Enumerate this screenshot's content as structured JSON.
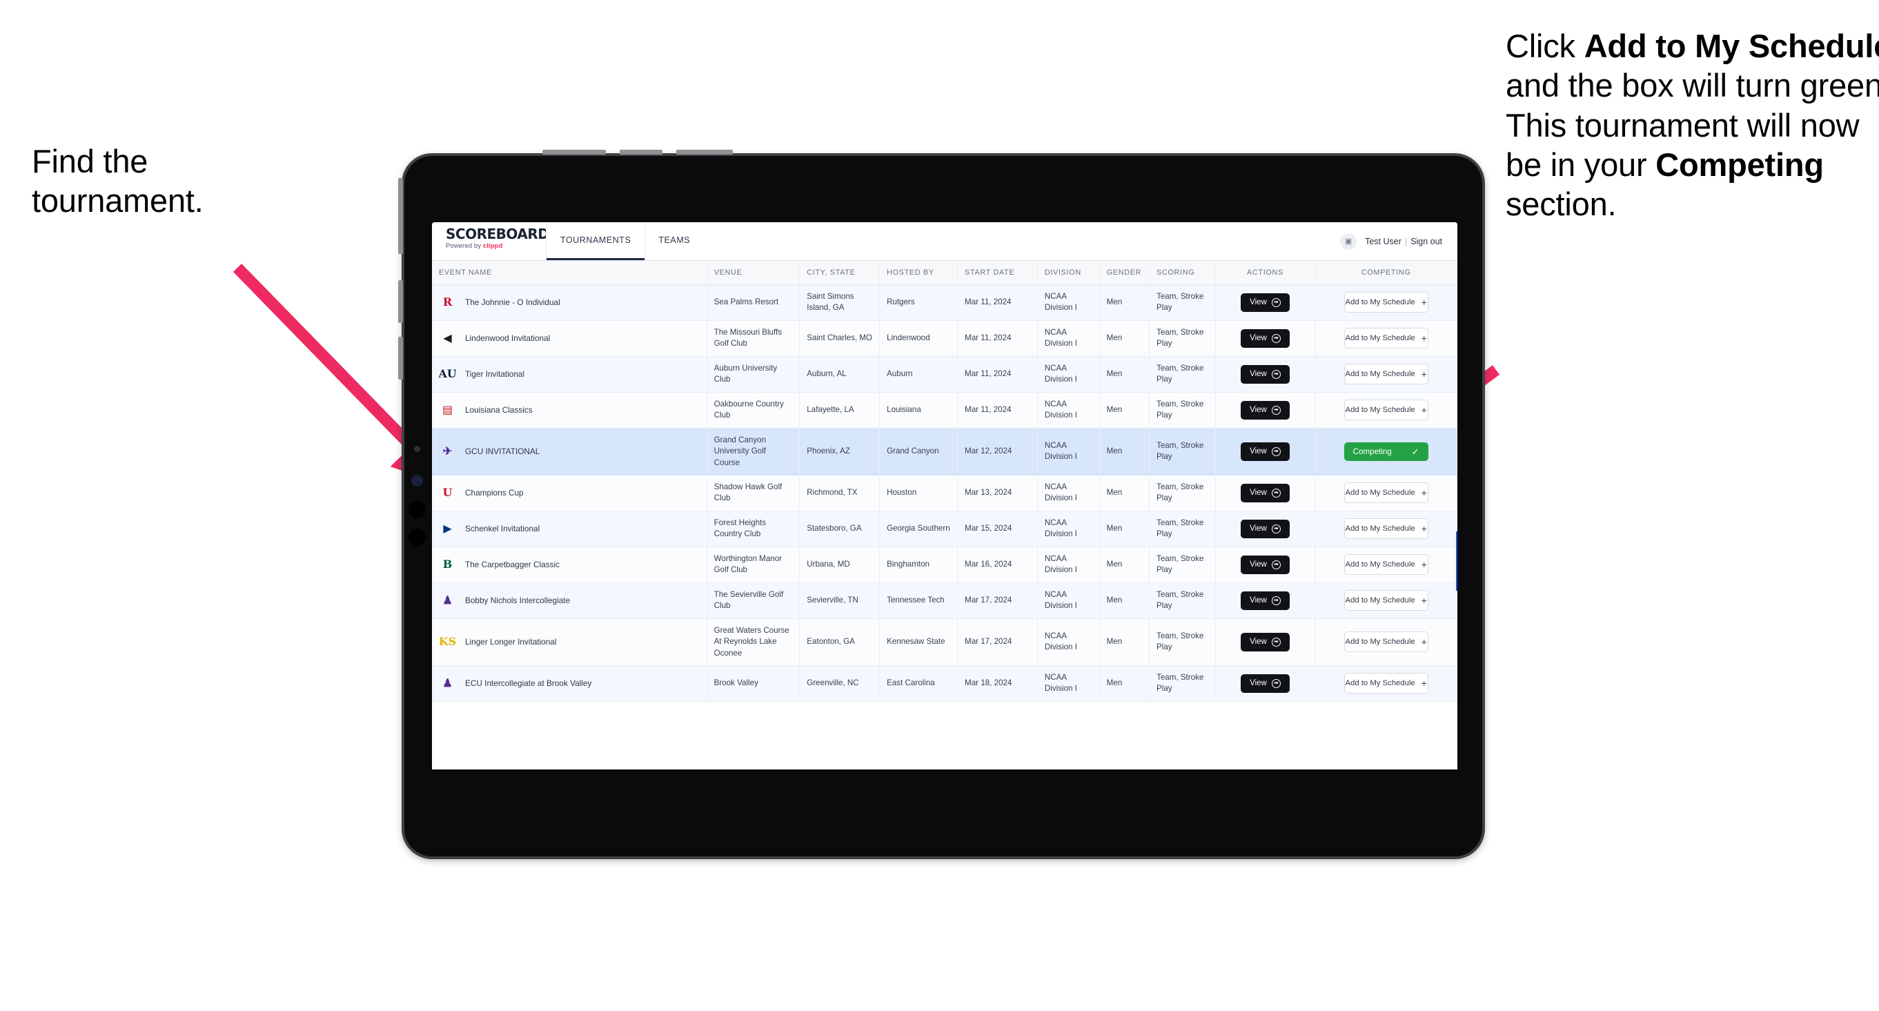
{
  "annotations": {
    "left": {
      "line1": "Find the",
      "line2": "tournament."
    },
    "right": {
      "p1a": "Click ",
      "p1b": "Add to My Schedule",
      "p1c": " and the box will turn green. This tournament will now be in your ",
      "p1d": "Competing",
      "p1e": " section."
    }
  },
  "app": {
    "brand": {
      "title": "SCOREBOARD",
      "powered_prefix": "Powered by ",
      "powered_brand": "clippd"
    },
    "nav": [
      {
        "label": "TOURNAMENTS",
        "active": true
      },
      {
        "label": "TEAMS",
        "active": false
      }
    ],
    "user": {
      "avatar_glyph": "▣",
      "name": "Test User",
      "separator": "|",
      "sign_out": "Sign out"
    },
    "table": {
      "columns": [
        "EVENT NAME",
        "VENUE",
        "CITY, STATE",
        "HOSTED BY",
        "START DATE",
        "DIVISION",
        "GENDER",
        "SCORING",
        "ACTIONS",
        "COMPETING"
      ],
      "view_label": "View",
      "add_label": "Add to My Schedule",
      "competing_label": "Competing",
      "rows": [
        {
          "event": "The Johnnie - O Individual",
          "venue": "Sea Palms Resort",
          "city": "Saint Simons Island, GA",
          "host": "Rutgers",
          "date": "Mar 11, 2024",
          "division": "NCAA Division I",
          "gender": "Men",
          "scoring": "Team, Stroke Play",
          "competing": false,
          "logo": {
            "text": "R",
            "color": "#c8102e",
            "bg": "transparent"
          }
        },
        {
          "event": "Lindenwood Invitational",
          "venue": "The Missouri Bluffs Golf Club",
          "city": "Saint Charles, MO",
          "host": "Lindenwood",
          "date": "Mar 11, 2024",
          "division": "NCAA Division I",
          "gender": "Men",
          "scoring": "Team, Stroke Play",
          "competing": false,
          "logo": {
            "text": "◀",
            "color": "#1d1d1d",
            "bg": "transparent"
          }
        },
        {
          "event": "Tiger Invitational",
          "venue": "Auburn University Club",
          "city": "Auburn, AL",
          "host": "Auburn",
          "date": "Mar 11, 2024",
          "division": "NCAA Division I",
          "gender": "Men",
          "scoring": "Team, Stroke Play",
          "competing": false,
          "logo": {
            "text": "AU",
            "color": "#0c2340",
            "bg": "transparent"
          }
        },
        {
          "event": "Louisiana Classics",
          "venue": "Oakbourne Country Club",
          "city": "Lafayette, LA",
          "host": "Louisiana",
          "date": "Mar 11, 2024",
          "division": "NCAA Division I",
          "gender": "Men",
          "scoring": "Team, Stroke Play",
          "competing": false,
          "logo": {
            "text": "▤",
            "color": "#ce181e",
            "bg": "transparent"
          }
        },
        {
          "event": "GCU INVITATIONAL",
          "venue": "Grand Canyon University Golf Course",
          "city": "Phoenix, AZ",
          "host": "Grand Canyon",
          "date": "Mar 12, 2024",
          "division": "NCAA Division I",
          "gender": "Men",
          "scoring": "Team, Stroke Play",
          "competing": true,
          "logo": {
            "text": "✈",
            "color": "#522398",
            "bg": "transparent"
          }
        },
        {
          "event": "Champions Cup",
          "venue": "Shadow Hawk Golf Club",
          "city": "Richmond, TX",
          "host": "Houston",
          "date": "Mar 13, 2024",
          "division": "NCAA Division I",
          "gender": "Men",
          "scoring": "Team, Stroke Play",
          "competing": false,
          "logo": {
            "text": "U",
            "color": "#c8102e",
            "bg": "transparent"
          }
        },
        {
          "event": "Schenkel Invitational",
          "venue": "Forest Heights Country Club",
          "city": "Statesboro, GA",
          "host": "Georgia Southern",
          "date": "Mar 15, 2024",
          "division": "NCAA Division I",
          "gender": "Men",
          "scoring": "Team, Stroke Play",
          "competing": false,
          "logo": {
            "text": "▶",
            "color": "#003775",
            "bg": "transparent"
          }
        },
        {
          "event": "The Carpetbagger Classic",
          "venue": "Worthington Manor Golf Club",
          "city": "Urbana, MD",
          "host": "Binghamton",
          "date": "Mar 16, 2024",
          "division": "NCAA Division I",
          "gender": "Men",
          "scoring": "Team, Stroke Play",
          "competing": false,
          "logo": {
            "text": "B",
            "color": "#005a43",
            "bg": "transparent"
          }
        },
        {
          "event": "Bobby Nichols Intercollegiate",
          "venue": "The Sevierville Golf Club",
          "city": "Sevierville, TN",
          "host": "Tennessee Tech",
          "date": "Mar 17, 2024",
          "division": "NCAA Division I",
          "gender": "Men",
          "scoring": "Team, Stroke Play",
          "competing": false,
          "logo": {
            "text": "♟",
            "color": "#542e91",
            "bg": "transparent"
          }
        },
        {
          "event": "Linger Longer Invitational",
          "venue": "Great Waters Course At Reynolds Lake Oconee",
          "city": "Eatonton, GA",
          "host": "Kennesaw State",
          "date": "Mar 17, 2024",
          "division": "NCAA Division I",
          "gender": "Men",
          "scoring": "Team, Stroke Play",
          "competing": false,
          "logo": {
            "text": "KS",
            "color": "#e3b100",
            "bg": "transparent"
          }
        },
        {
          "event": "ECU Intercollegiate at Brook Valley",
          "venue": "Brook Valley",
          "city": "Greenville, NC",
          "host": "East Carolina",
          "date": "Mar 18, 2024",
          "division": "NCAA Division I",
          "gender": "Men",
          "scoring": "Team, Stroke Play",
          "competing": false,
          "logo": {
            "text": "♟",
            "color": "#592a8a",
            "bg": "transparent"
          }
        }
      ]
    }
  },
  "colors": {
    "accent_pink": "#ee2a62",
    "competing_green": "#22a244",
    "selected_row_blue": "#d8e6fb",
    "brand_red": "#ef2d56"
  }
}
